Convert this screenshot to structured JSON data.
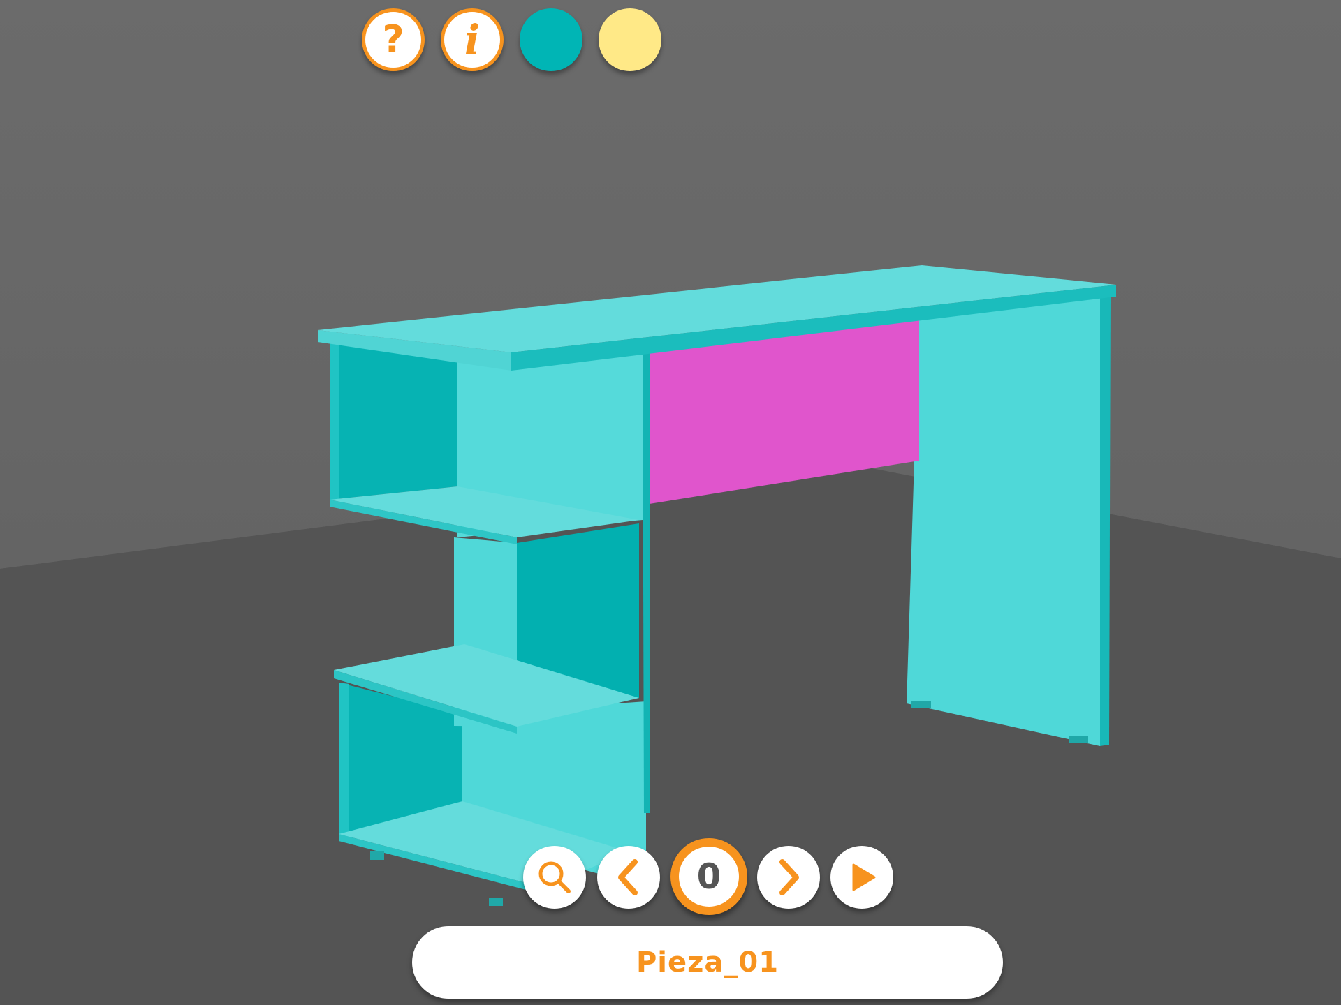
{
  "colors": {
    "accent": "#f7931e",
    "swatch_1": "#00b5b5",
    "swatch_2": "#ffe987",
    "desk_body": "#4fd8d8",
    "desk_panel": "#e055cc",
    "wall": "#696969",
    "floor": "#545454"
  },
  "toolbar_top": {
    "help": {
      "icon": "question-icon",
      "glyph": "?"
    },
    "info": {
      "icon": "info-icon",
      "glyph": "i"
    },
    "swatches": [
      {
        "icon": "color-swatch-teal",
        "color": "#00b5b5"
      },
      {
        "icon": "color-swatch-yellow",
        "color": "#ffe987"
      }
    ]
  },
  "toolbar_bottom": {
    "zoom": {
      "icon": "magnifier-icon"
    },
    "prev": {
      "icon": "chevron-left-icon"
    },
    "counter": {
      "value": "0"
    },
    "next": {
      "icon": "chevron-right-icon"
    },
    "play": {
      "icon": "play-icon"
    }
  },
  "part_label": "Pieza_01"
}
